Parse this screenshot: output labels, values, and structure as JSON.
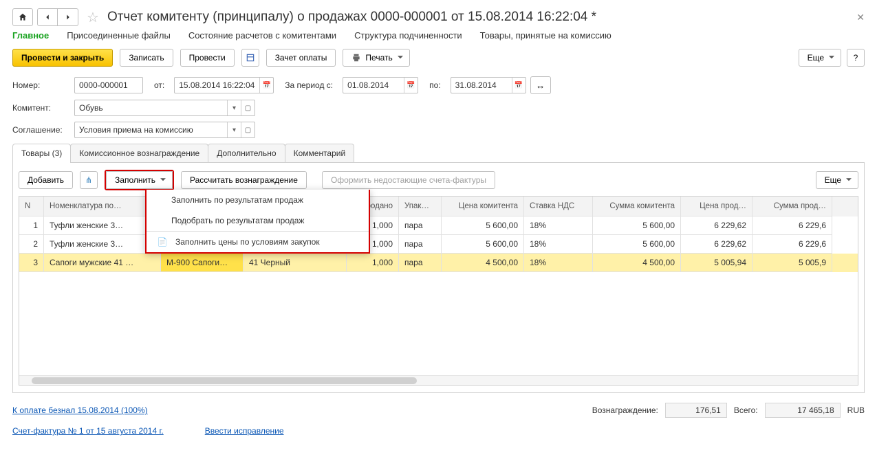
{
  "title": "Отчет комитенту (принципалу) о продажах 0000-000001 от 15.08.2014 16:22:04 *",
  "topTabs": {
    "main": "Главное",
    "files": "Присоединенные файлы",
    "settle": "Состояние расчетов с комитентами",
    "struct": "Структура подчиненности",
    "goods": "Товары, принятые на комиссию"
  },
  "cmd": {
    "postClose": "Провести и закрыть",
    "save": "Записать",
    "post": "Провести",
    "offset": "Зачет оплаты",
    "print": "Печать",
    "more": "Еще",
    "help": "?"
  },
  "form": {
    "number_lbl": "Номер:",
    "number": "0000-000001",
    "from_lbl": "от:",
    "from": "15.08.2014 16:22:04",
    "period_lbl": "За период с:",
    "period_from": "01.08.2014",
    "to_lbl": "по:",
    "period_to": "31.08.2014",
    "komitent_lbl": "Комитент:",
    "komitent": "Обувь",
    "agreement_lbl": "Соглашение:",
    "agreement": "Условия приема на комиссию"
  },
  "subTabs": {
    "goods": "Товары (3)",
    "fee": "Комиссионное вознаграждение",
    "extra": "Дополнительно",
    "comment": "Комментарий"
  },
  "panel": {
    "add": "Добавить",
    "fill": "Заполнить",
    "calc": "Рассчитать вознаграждение",
    "invoices": "Оформить недостающие счета-фактуры",
    "more": "Еще",
    "dd1": "Заполнить по результатам продаж",
    "dd2": "Подобрать по результатам продаж",
    "dd3": "Заполнить цены по условиям закупок"
  },
  "grid": {
    "cols": {
      "n": "N",
      "nom": "Номенклатура по…",
      "art": "",
      "char": "",
      "sold": "Продано",
      "pack": "Упак…",
      "price": "Цена комитента",
      "vat": "Ставка НДС",
      "sum": "Сумма комитента",
      "priceS": "Цена прод…",
      "sumS": "Сумма прод…"
    },
    "rows": [
      {
        "n": "1",
        "nom": "Туфли женские 3…",
        "art": "",
        "char": "",
        "sold": "1,000",
        "pack": "пара",
        "price": "5 600,00",
        "vat": "18%",
        "sum": "5 600,00",
        "priceS": "6 229,62",
        "sumS": "6 229,6"
      },
      {
        "n": "2",
        "nom": "Туфли женские 3…",
        "art": "",
        "char": "",
        "sold": "1,000",
        "pack": "пара",
        "price": "5 600,00",
        "vat": "18%",
        "sum": "5 600,00",
        "priceS": "6 229,62",
        "sumS": "6 229,6"
      },
      {
        "n": "3",
        "nom": "Сапоги мужские 41 …",
        "art": "М-900 Сапоги…",
        "char": "41 Черный",
        "sold": "1,000",
        "pack": "пара",
        "price": "4 500,00",
        "vat": "18%",
        "sum": "4 500,00",
        "priceS": "5 005,94",
        "sumS": "5 005,9"
      }
    ]
  },
  "footer": {
    "payLink": "К оплате безнал 15.08.2014 (100%)",
    "fee_lbl": "Вознаграждение:",
    "fee_val": "176,51",
    "total_lbl": "Всего:",
    "total_val": "17 465,18",
    "cur": "RUB",
    "invoiceLink": "Счет-фактура № 1 от 15 августа 2014 г.",
    "correctionLink": "Ввести исправление"
  }
}
